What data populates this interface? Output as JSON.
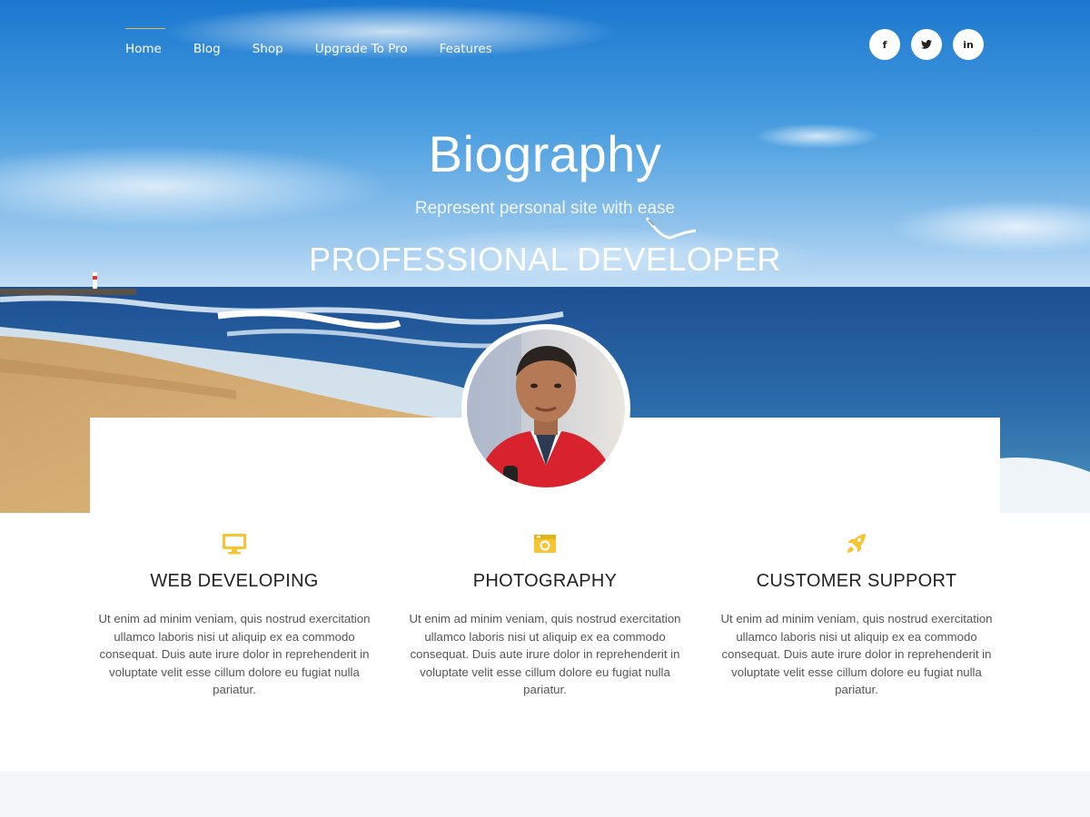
{
  "nav": {
    "items": [
      {
        "label": "Home",
        "active": true
      },
      {
        "label": "Blog",
        "active": false
      },
      {
        "label": "Shop",
        "active": false
      },
      {
        "label": "Upgrade To Pro",
        "active": false
      },
      {
        "label": "Features",
        "active": false
      }
    ]
  },
  "social": [
    {
      "icon": "facebook-icon",
      "glyph": "f"
    },
    {
      "icon": "twitter-icon",
      "glyph": "t"
    },
    {
      "icon": "linkedin-icon",
      "glyph": "in"
    }
  ],
  "hero": {
    "title": "Biography",
    "tagline": "Represent personal site with ease",
    "role": "PROFESSIONAL DEVELOPER"
  },
  "features": [
    {
      "icon": "monitor-icon",
      "title": "WEB DEVELOPING",
      "text": "Ut enim ad minim veniam, quis nostrud exercitation ullamco laboris nisi ut aliquip ex ea commodo consequat. Duis aute irure dolor in reprehenderit in voluptate velit esse cillum dolore eu fugiat nulla pariatur."
    },
    {
      "icon": "camera-icon",
      "title": "PHOTOGRAPHY",
      "text": "Ut enim ad minim veniam, quis nostrud exercitation ullamco laboris nisi ut aliquip ex ea commodo consequat. Duis aute irure dolor in reprehenderit in voluptate velit esse cillum dolore eu fugiat nulla pariatur."
    },
    {
      "icon": "rocket-icon",
      "title": "CUSTOMER SUPPORT",
      "text": "Ut enim ad minim veniam, quis nostrud exercitation ullamco laboris nisi ut aliquip ex ea commodo consequat. Duis aute irure dolor in reprehenderit in voluptate velit esse cillum dolore eu fugiat nulla pariatur."
    }
  ],
  "colors": {
    "accent": "#f6c531",
    "nav_active_line": "#e8b84a",
    "heading": "#222222",
    "body_text": "#555555"
  }
}
